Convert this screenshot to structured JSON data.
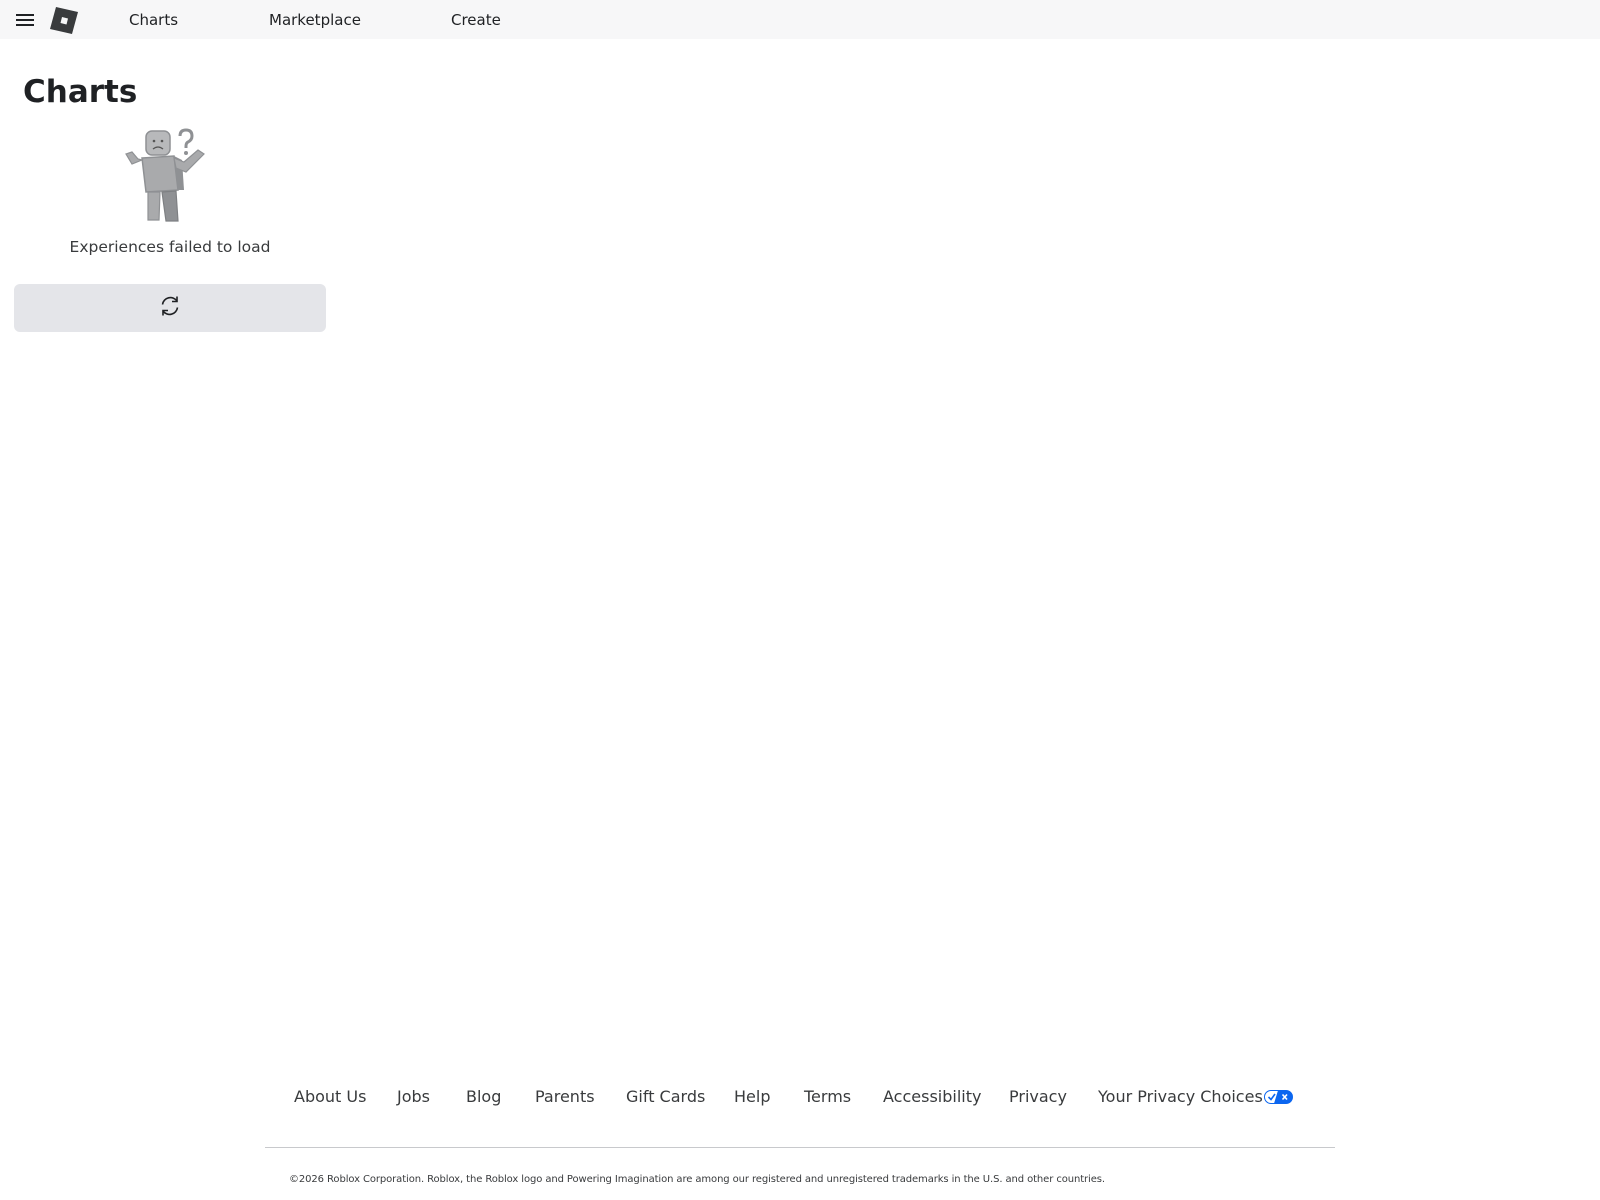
{
  "header": {
    "nav": [
      {
        "label": "Charts"
      },
      {
        "label": "Marketplace"
      },
      {
        "label": "Create"
      }
    ]
  },
  "main": {
    "title": "Charts",
    "error_message": "Experiences failed to load",
    "reload_icon": "refresh-icon"
  },
  "footer": {
    "links": [
      {
        "label": "About Us"
      },
      {
        "label": "Jobs"
      },
      {
        "label": "Blog"
      },
      {
        "label": "Parents"
      },
      {
        "label": "Gift Cards"
      },
      {
        "label": "Help"
      },
      {
        "label": "Terms"
      },
      {
        "label": "Accessibility"
      },
      {
        "label": "Privacy"
      },
      {
        "label": "Your Privacy Choices"
      }
    ],
    "copyright": "©2026 Roblox Corporation. Roblox, the Roblox logo and Powering Imagination are among our registered and unregistered trademarks in the U.S. and other countries."
  },
  "colors": {
    "topbar_bg": "#f7f7f8",
    "button_bg": "#e4e5e9",
    "privacy_badge": "#0b66f0",
    "text": "#393b3d"
  }
}
